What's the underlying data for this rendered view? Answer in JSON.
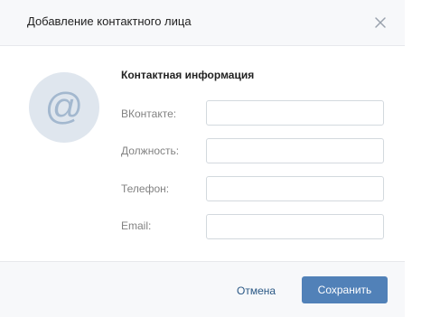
{
  "dialog": {
    "title": "Добавление контактного лица",
    "close_icon": "close-icon"
  },
  "avatar": {
    "icon": "at-sign-icon",
    "glyph": "@"
  },
  "section": {
    "title": "Контактная информация"
  },
  "fields": [
    {
      "label": "ВКонтакте:",
      "value": "",
      "placeholder": ""
    },
    {
      "label": "Должность:",
      "value": "",
      "placeholder": ""
    },
    {
      "label": "Телефон:",
      "value": "",
      "placeholder": ""
    },
    {
      "label": "Email:",
      "value": "",
      "placeholder": ""
    }
  ],
  "footer": {
    "cancel_label": "Отмена",
    "save_label": "Сохранить"
  },
  "colors": {
    "accent": "#5181b8",
    "link": "#2a5885",
    "avatar_bg": "#dfe6ee",
    "avatar_fg": "#a3b8cf",
    "header_bg": "#f7f8fa",
    "border": "#e7e8ec"
  }
}
